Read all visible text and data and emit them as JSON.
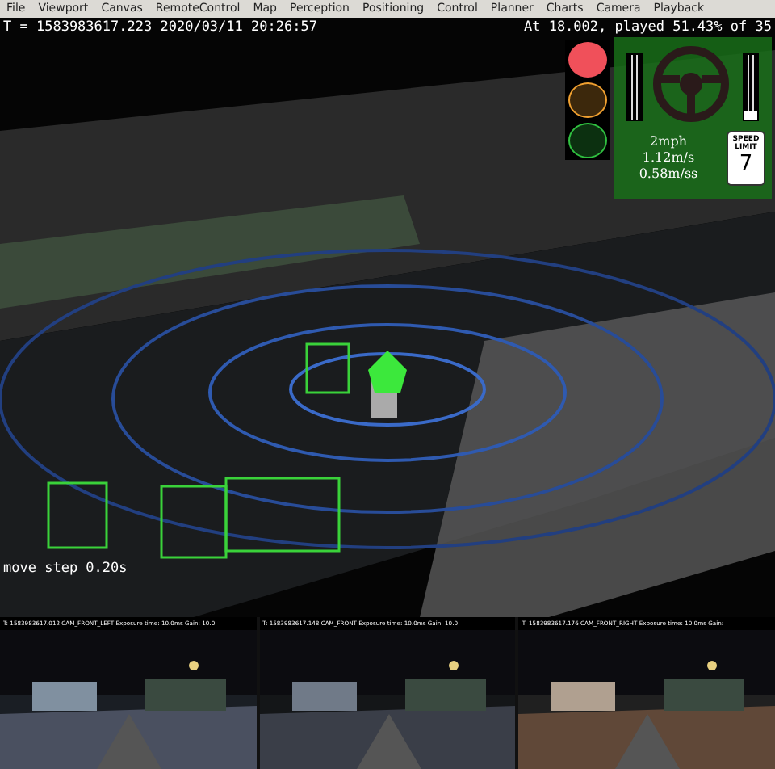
{
  "menu": [
    {
      "label": "File"
    },
    {
      "label": "Viewport"
    },
    {
      "label": "Canvas"
    },
    {
      "label": "RemoteControl"
    },
    {
      "label": "Map"
    },
    {
      "label": "Perception"
    },
    {
      "label": "Positioning"
    },
    {
      "label": "Control"
    },
    {
      "label": "Planner"
    },
    {
      "label": "Charts"
    },
    {
      "label": "Camera"
    },
    {
      "label": "Playback"
    }
  ],
  "view": {
    "timestamp": "T = 1583983617.223  2020/03/11 20:26:57",
    "playback": "At 18.002, played 51.43% of 35",
    "move_step": "move step 0.20s"
  },
  "hud": {
    "traffic_light": [
      {
        "color": "#f0505a",
        "on": true
      },
      {
        "color": "#f0a030",
        "on": false
      },
      {
        "color": "#30c040",
        "on": false
      }
    ],
    "pedals": [
      {
        "level": 0
      },
      {
        "level": 0.12
      }
    ],
    "speed_mph": "2mph",
    "speed_ms": "1.12m/s",
    "accel": "0.58m/ss",
    "speed_limit_label": "SPEED LIMIT",
    "speed_limit": "7"
  },
  "cameras": [
    {
      "caption": "T: 1583983617.012 CAM_FRONT_LEFT Exposure time: 10.0ms Gain: 10.0"
    },
    {
      "caption": "T: 1583983617.148 CAM_FRONT Exposure time: 10.0ms Gain: 10.0"
    },
    {
      "caption": "T: 1583983617.176 CAM_FRONT_RIGHT Exposure time: 10.0ms Gain:"
    }
  ]
}
